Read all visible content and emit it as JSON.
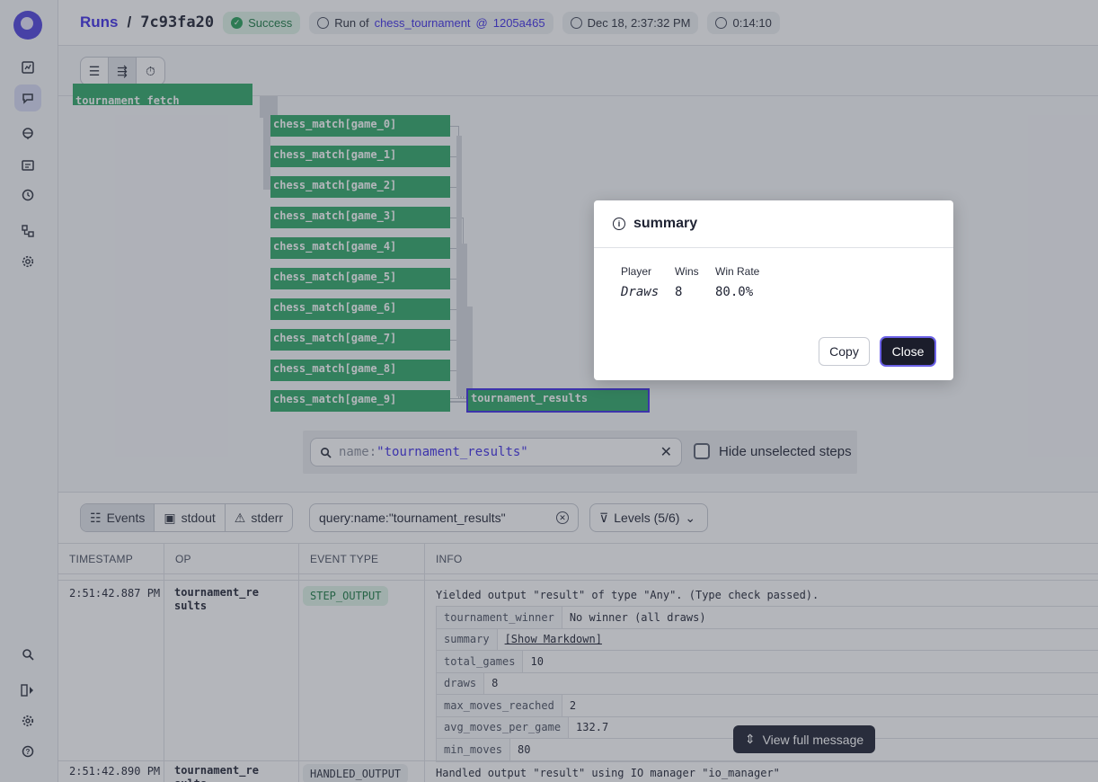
{
  "header": {
    "runs_label": "Runs",
    "separator": "/",
    "run_id": "7c93fa20",
    "status": "Success",
    "run_of_prefix": "Run of",
    "job_name": "chess_tournament",
    "at": "@",
    "snapshot": "1205a465",
    "started": "Dec 18, 2:37:32 PM",
    "duration": "0:14:10"
  },
  "graph": {
    "top_bar_label": "tournament_fetch",
    "steps": [
      "chess_match[game_0]",
      "chess_match[game_1]",
      "chess_match[game_2]",
      "chess_match[game_3]",
      "chess_match[game_4]",
      "chess_match[game_5]",
      "chess_match[game_6]",
      "chess_match[game_7]",
      "chess_match[game_8]",
      "chess_match[game_9]"
    ],
    "selected_step": "tournament_results",
    "search_key": "name:",
    "search_value": "\"tournament_results\"",
    "hide_unselected_label": "Hide unselected steps"
  },
  "logs": {
    "tabs": [
      "Events",
      "stdout",
      "stderr"
    ],
    "filter_query": "query:name:\"tournament_results\"",
    "levels_label": "Levels (5/6)",
    "columns": [
      "TIMESTAMP",
      "OP",
      "EVENT TYPE",
      "INFO"
    ],
    "rows": [
      {
        "timestamp": "2:51:42.887 PM",
        "op": "tournament_results",
        "event_type": "STEP_OUTPUT",
        "info": "Yielded output \"result\" of type \"Any\". (Type check passed).",
        "metadata": [
          {
            "key": "tournament_winner",
            "value": "No winner (all draws)"
          },
          {
            "key": "summary",
            "value": "[Show Markdown]"
          },
          {
            "key": "total_games",
            "value": "10"
          },
          {
            "key": "draws",
            "value": "8"
          },
          {
            "key": "max_moves_reached",
            "value": "2"
          },
          {
            "key": "avg_moves_per_game",
            "value": "132.7"
          },
          {
            "key": "min_moves",
            "value": "80"
          }
        ]
      },
      {
        "timestamp": "2:51:42.890 PM",
        "op": "tournament_results",
        "event_type": "HANDLED_OUTPUT",
        "info": "Handled output \"result\" using IO manager \"io_manager\""
      }
    ],
    "view_full_label": "View full message"
  },
  "dialog": {
    "title": "summary",
    "headers": [
      "Player",
      "Wins",
      "Win Rate"
    ],
    "row": [
      "Draws",
      "8",
      "80.0%"
    ],
    "copy_label": "Copy",
    "close_label": "Close"
  },
  "colors": {
    "accent": "#3f2ee6",
    "step_bar": "#2fa868",
    "success_bg": "#dff4e7"
  }
}
